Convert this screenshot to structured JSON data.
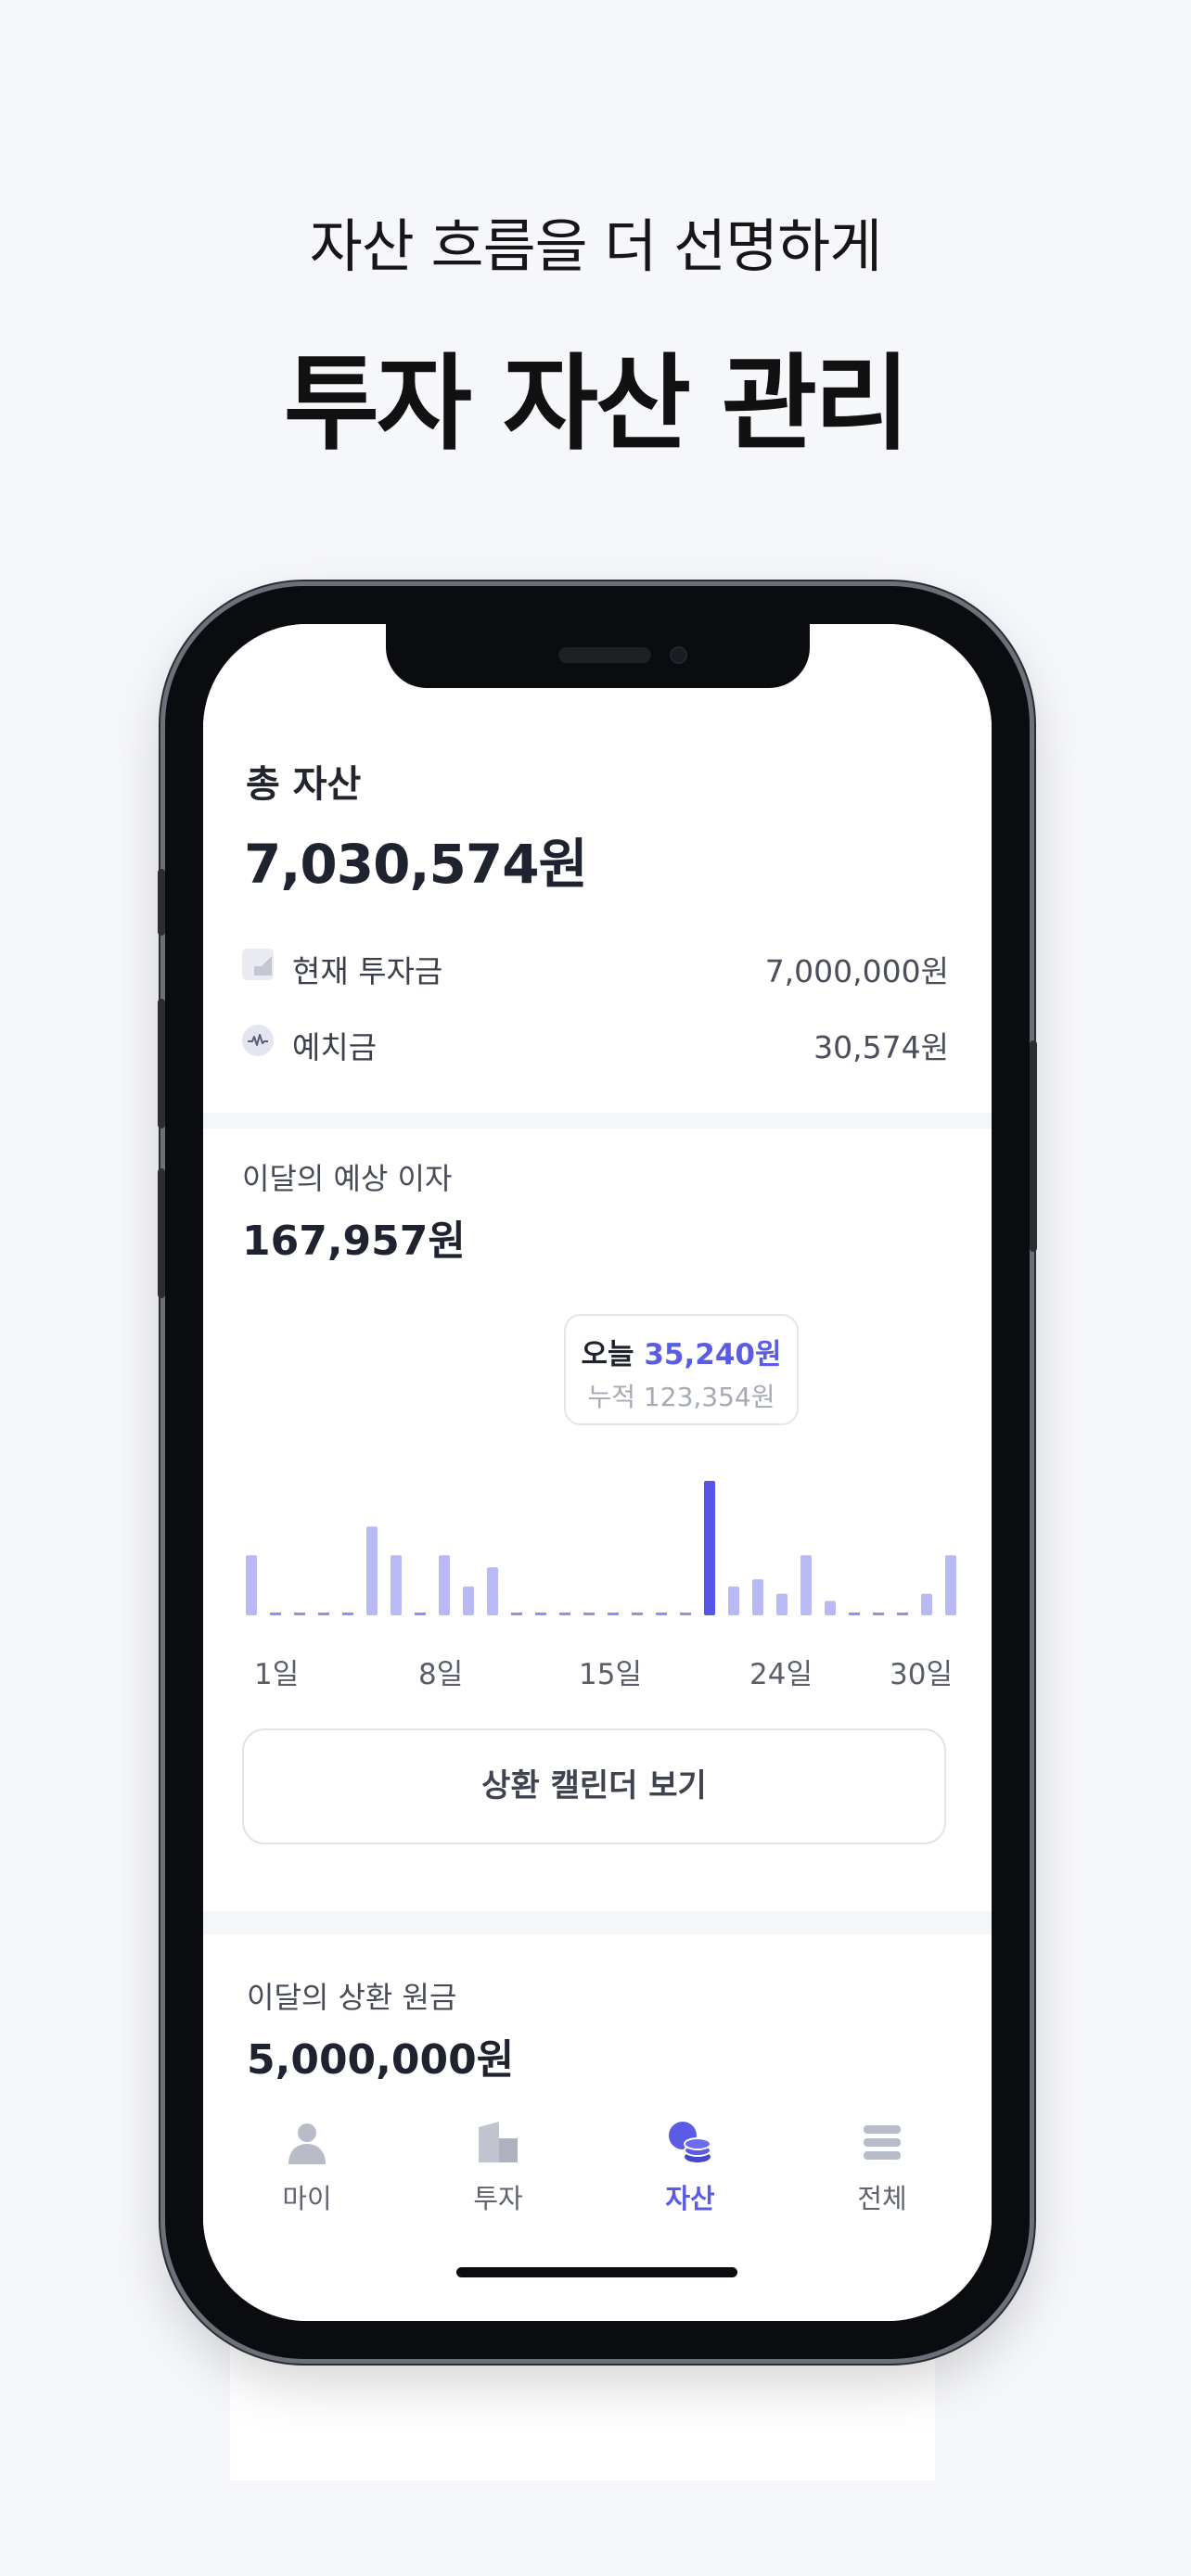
{
  "promo": {
    "subtitle": "자산 흐름을 더 선명하게",
    "title": "투자 자산 관리"
  },
  "total": {
    "label": "총 자산",
    "amount": "7,030,574원",
    "rows": [
      {
        "icon": "growth-step-icon",
        "label": "현재 투자금",
        "value": "7,000,000원"
      },
      {
        "icon": "pulse-coin-icon",
        "label": "예치금",
        "value": "30,574원"
      }
    ]
  },
  "interest": {
    "label": "이달의 예상 이자",
    "amount": "167,957원",
    "tooltip": {
      "today_prefix": "오늘",
      "today_value": "35,240원",
      "cumulative": "누적 123,354원"
    },
    "x_ticks": [
      "1일",
      "8일",
      "15일",
      "24일",
      "30일"
    ],
    "calendar_button": "상환 캘린더 보기"
  },
  "chart_data": {
    "type": "bar",
    "categories": [
      "1",
      "2",
      "3",
      "4",
      "5",
      "6",
      "7",
      "8",
      "9",
      "10",
      "11",
      "12",
      "13",
      "14",
      "15",
      "16",
      "17",
      "18",
      "19",
      "20",
      "21",
      "22",
      "23",
      "24",
      "25",
      "26",
      "27",
      "28",
      "29",
      "30"
    ],
    "values": [
      2.5,
      0,
      0,
      0,
      0,
      3.7,
      2.5,
      0,
      2.5,
      1.2,
      2.0,
      0,
      0,
      0,
      0,
      0,
      0,
      0,
      0,
      5.6,
      1.2,
      1.5,
      0.9,
      2.5,
      0.6,
      0,
      0,
      0,
      0.9,
      2.5
    ],
    "highlight_index": 19,
    "colors": {
      "bar": "#b8baf6",
      "highlight": "#5556e8",
      "zero": "#8f91ee"
    }
  },
  "repay": {
    "label": "이달의 상환 원금",
    "amount": "5,000,000원"
  },
  "tabs": [
    {
      "label": "마이",
      "icon": "person-icon",
      "active": false
    },
    {
      "label": "투자",
      "icon": "buildings-icon",
      "active": false
    },
    {
      "label": "자산",
      "icon": "coins-icon",
      "active": true
    },
    {
      "label": "전체",
      "icon": "menu-icon",
      "active": false
    }
  ],
  "colors": {
    "accent": "#5b5ce6",
    "background": "#f6f7fa"
  }
}
